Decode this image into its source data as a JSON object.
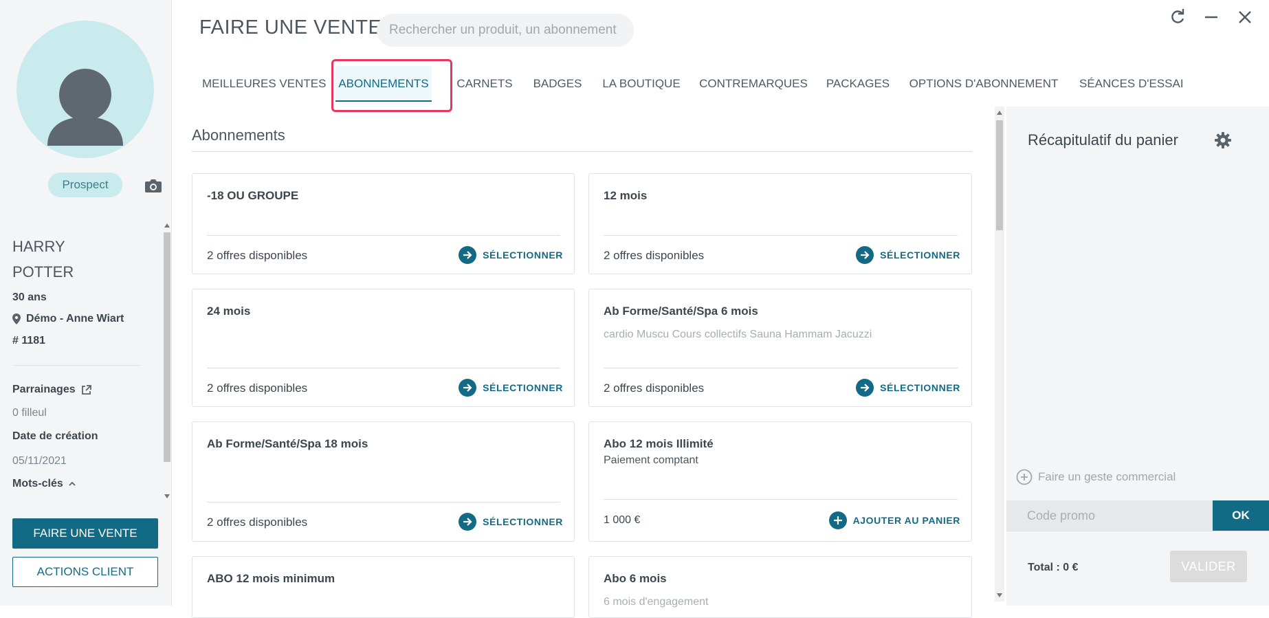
{
  "header": {
    "title": "FAIRE UNE VENTE",
    "search_placeholder": "Rechercher un produit, un abonnement"
  },
  "tabs": [
    {
      "label": "MEILLEURES VENTES",
      "active": false
    },
    {
      "label": "ABONNEMENTS",
      "active": true
    },
    {
      "label": "CARNETS",
      "active": false
    },
    {
      "label": "BADGES",
      "active": false
    },
    {
      "label": "LA BOUTIQUE",
      "active": false
    },
    {
      "label": "CONTREMARQUES",
      "active": false
    },
    {
      "label": "PACKAGES",
      "active": false
    },
    {
      "label": "OPTIONS D'ABONNEMENT",
      "active": false
    },
    {
      "label": "SÉANCES D'ESSAI",
      "active": false
    }
  ],
  "client": {
    "status": "Prospect",
    "first_name": "HARRY",
    "last_name": "POTTER",
    "age": "30 ans",
    "location": "Démo - Anne Wiart",
    "id": "# 1181",
    "parrainages_label": "Parrainages",
    "filleul": "0 filleul",
    "date_label": "Date de création",
    "date_value": "05/11/2021",
    "keywords_label": "Mots-clés",
    "sell_button": "FAIRE UNE VENTE",
    "actions_button": "ACTIONS CLIENT"
  },
  "main": {
    "section_title": "Abonnements",
    "cards": [
      {
        "title": "-18 OU GROUPE",
        "desc": "",
        "footer": "2 offres disponibles",
        "action": "SÉLECTIONNER"
      },
      {
        "title": "12 mois",
        "desc": "",
        "footer": "2 offres disponibles",
        "action": "SÉLECTIONNER"
      },
      {
        "title": "24 mois",
        "desc": "",
        "footer": "2 offres disponibles",
        "action": "SÉLECTIONNER"
      },
      {
        "title": "Ab Forme/Santé/Spa 6 mois",
        "desc": "cardio Muscu Cours collectifs Sauna Hammam Jacuzzi",
        "footer": "2 offres disponibles",
        "action": "SÉLECTIONNER"
      },
      {
        "title": "Ab Forme/Santé/Spa 18 mois",
        "desc": "",
        "footer": "2 offres disponibles",
        "action": "SÉLECTIONNER"
      },
      {
        "title": "Abo 12 mois Illimité",
        "desc": "Paiement comptant",
        "footer": "1 000 €",
        "action": "AJOUTER AU PANIER"
      },
      {
        "title": "ABO 12 mois minimum",
        "desc": "",
        "footer": "",
        "action": ""
      },
      {
        "title": "Abo 6 mois",
        "desc": "6 mois d'engagement",
        "footer": "",
        "action": ""
      }
    ]
  },
  "cart": {
    "title": "Récapitulatif du panier",
    "geste": "Faire un geste commercial",
    "promo_placeholder": "Code promo",
    "ok": "OK",
    "total": "Total : 0 €",
    "validate": "VALIDER"
  },
  "colors": {
    "primary": "#136a85",
    "highlight": "#e3385f",
    "avatar_bg": "#c9ebee"
  }
}
